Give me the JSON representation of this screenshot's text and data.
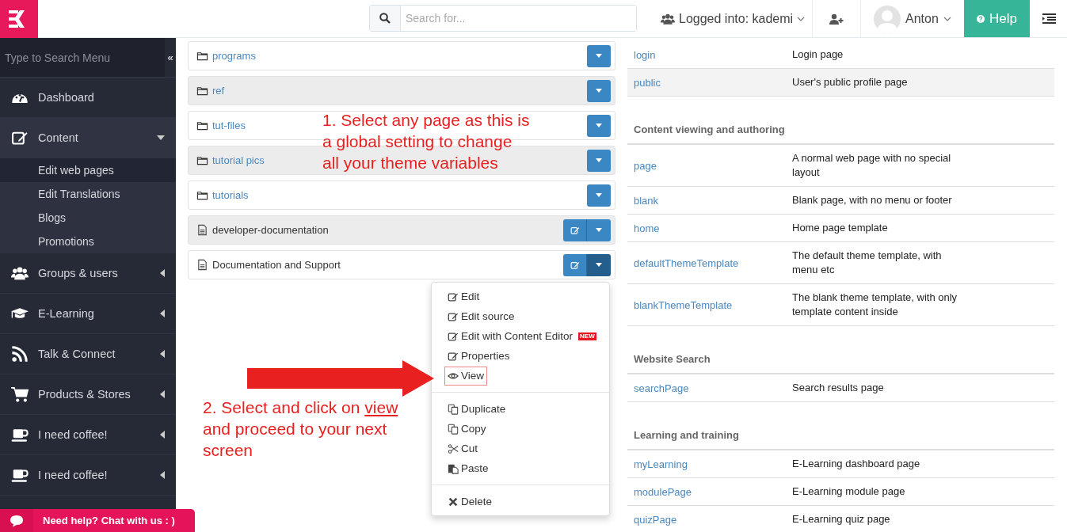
{
  "header": {
    "search": {
      "placeholder": "Search for..."
    },
    "account": "Logged into: kademi",
    "user": "Anton",
    "help": "Help"
  },
  "sidebar": {
    "search": {
      "placeholder": "Type to Search Menu"
    },
    "collapse": "«",
    "items": [
      {
        "label": "Dashboard",
        "kind": "dashboard"
      },
      {
        "label": "Content",
        "kind": "edit",
        "expanded": true,
        "children": [
          {
            "label": "Edit web pages",
            "selected": true
          },
          {
            "label": "Edit Translations",
            "selected": false
          },
          {
            "label": "Blogs",
            "selected": false
          },
          {
            "label": "Promotions",
            "selected": false
          }
        ]
      },
      {
        "label": "Groups & users",
        "kind": "users",
        "expanded": false
      },
      {
        "label": "E-Learning",
        "kind": "cap",
        "expanded": false
      },
      {
        "label": "Talk & Connect",
        "kind": "rss",
        "expanded": false
      },
      {
        "label": "Products & Stores",
        "kind": "cart",
        "expanded": false
      },
      {
        "label": "I need coffee!",
        "kind": "coffee",
        "expanded": false
      },
      {
        "label": "I need coffee!",
        "kind": "coffee",
        "expanded": false
      }
    ]
  },
  "pages": [
    {
      "name": "programs",
      "kind": "folder",
      "open": false
    },
    {
      "name": "ref",
      "kind": "folder",
      "open": false
    },
    {
      "name": "tut-files",
      "kind": "folder",
      "open": false
    },
    {
      "name": "tutorial pics",
      "kind": "folder",
      "open": false
    },
    {
      "name": "tutorials",
      "kind": "folder",
      "open": false
    },
    {
      "name": "developer-documentation",
      "kind": "file",
      "open": false
    },
    {
      "name": "Documentation and Support",
      "kind": "file",
      "open": true
    }
  ],
  "menu": {
    "groups": [
      {
        "items": [
          {
            "label": "Edit",
            "kind": "edit"
          },
          {
            "label": "Edit source",
            "kind": "edit"
          },
          {
            "label": "Edit with Content Editor",
            "kind": "edit",
            "badge": "NEW"
          },
          {
            "label": "Properties",
            "kind": "edit"
          },
          {
            "label": "View",
            "kind": "eye",
            "outlined": true
          }
        ]
      },
      {
        "items": [
          {
            "label": "Duplicate",
            "kind": "copy"
          },
          {
            "label": "Copy",
            "kind": "copy"
          },
          {
            "label": "Cut",
            "kind": "scissors"
          },
          {
            "label": "Paste",
            "kind": "paste"
          }
        ]
      },
      {
        "items": [
          {
            "label": "Delete",
            "kind": "times"
          }
        ]
      }
    ]
  },
  "templates": {
    "sections": [
      {
        "rows": [
          {
            "name": "login",
            "description": "Login page",
            "hovered": false
          },
          {
            "name": "public",
            "description": "User's public profile page",
            "hovered": true
          }
        ]
      },
      {
        "heading": "Content viewing and authoring",
        "rows": [
          {
            "name": "page",
            "description": "A normal web page with no special layout",
            "hovered": false
          },
          {
            "name": "blank",
            "description": "Blank page, with no menu or footer",
            "hovered": false
          },
          {
            "name": "home",
            "description": "Home page template",
            "hovered": false
          },
          {
            "name": "defaultThemeTemplate",
            "description": "The default theme template, with menu etc",
            "hovered": false
          },
          {
            "name": "blankThemeTemplate",
            "description": "The blank theme template, with only template content inside",
            "hovered": false
          }
        ]
      },
      {
        "heading": "Website Search",
        "rows": [
          {
            "name": "searchPage",
            "description": "Search results page",
            "hovered": false
          }
        ]
      },
      {
        "heading": "Learning and training",
        "rows": [
          {
            "name": "myLearning",
            "description": "E-Learning dashboard page",
            "hovered": false
          },
          {
            "name": "modulePage",
            "description": "E-Learning module page",
            "hovered": false
          },
          {
            "name": "quizPage",
            "description": "E-Learning quiz page",
            "hovered": false
          }
        ]
      }
    ]
  },
  "annotations": [
    {
      "lines": [
        [
          {
            "text": "1. Select any page as this is"
          }
        ],
        [
          {
            "text": "a global setting to change"
          }
        ],
        [
          {
            "text": "all your theme variables"
          }
        ]
      ]
    },
    {
      "lines": [
        [
          {
            "text": "2. Select and click on "
          },
          {
            "text": "view",
            "underlined": true
          }
        ],
        [
          {
            "text": "and proceed to your next"
          }
        ],
        [
          {
            "text": "screen"
          }
        ]
      ]
    }
  ],
  "chat": {
    "label": "Need help? Chat with us : )"
  }
}
